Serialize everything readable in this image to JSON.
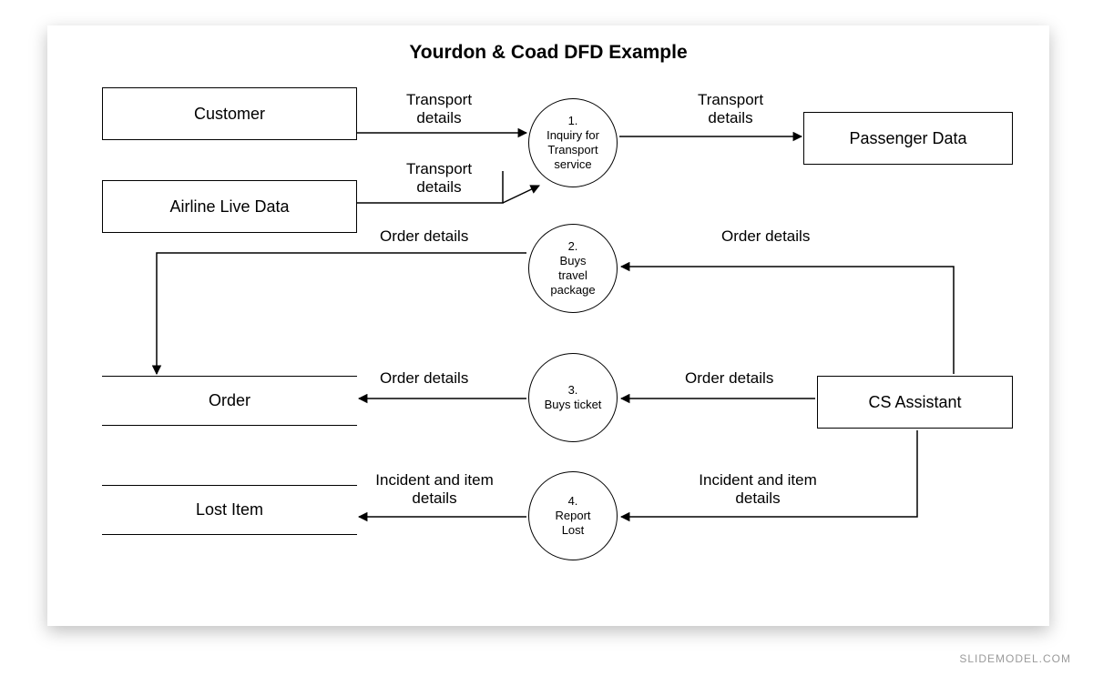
{
  "title": "Yourdon & Coad DFD Example",
  "watermark": "SLIDEMODEL.COM",
  "entities": {
    "customer": "Customer",
    "airline": "Airline Live Data",
    "passenger": "Passenger Data",
    "cs": "CS Assistant"
  },
  "datastores": {
    "order": "Order",
    "lost": "Lost Item"
  },
  "processes": {
    "p1_num": "1.",
    "p1_l1": "Inquiry for",
    "p1_l2": "Transport",
    "p1_l3": "service",
    "p2_num": "2.",
    "p2_l1": "Buys",
    "p2_l2": "travel",
    "p2_l3": "package",
    "p3_num": "3.",
    "p3_l1": "Buys ticket",
    "p4_num": "4.",
    "p4_l1": "Report",
    "p4_l2": "Lost"
  },
  "flows": {
    "f1": "Transport\ndetails",
    "f2": "Transport\ndetails",
    "f3": "Transport\ndetails",
    "f4": "Order details",
    "f5": "Order details",
    "f6": "Order details",
    "f7": "Order details",
    "f8": "Incident and item\ndetails",
    "f9": "Incident and item\ndetails"
  }
}
